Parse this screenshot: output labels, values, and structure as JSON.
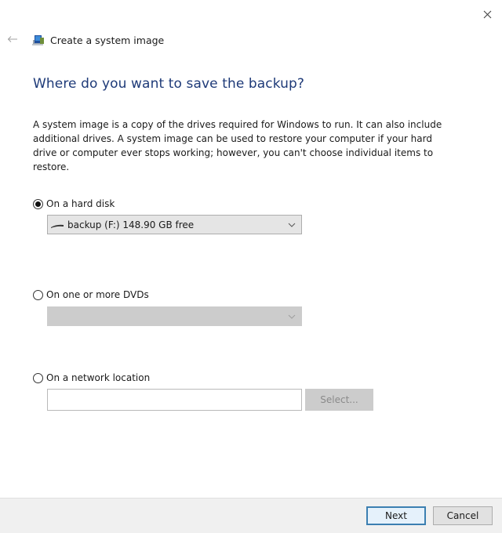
{
  "window": {
    "close_icon": "close-icon",
    "back_icon": "back-arrow-icon"
  },
  "wizard": {
    "title": "Create a system image",
    "app_icon": "system-image-icon"
  },
  "heading": "Where do you want to save the backup?",
  "description": "A system image is a copy of the drives required for Windows to run. It can also include additional drives. A system image can be used to restore your computer if your hard drive or computer ever stops working; however, you can't choose individual items to restore.",
  "options": {
    "hard_disk": {
      "label": "On a hard disk",
      "selected": true,
      "dropdown_value": "backup (F:)  148.90 GB free",
      "dropdown_icon": "drive-icon"
    },
    "dvds": {
      "label": "On one or more DVDs",
      "selected": false,
      "dropdown_value": "",
      "disabled": true
    },
    "network": {
      "label": "On a network location",
      "selected": false,
      "input_value": "",
      "select_button": "Select...",
      "select_disabled": true
    }
  },
  "footer": {
    "next_label": "Next",
    "cancel_label": "Cancel"
  },
  "colors": {
    "heading": "#1e3a78",
    "primary_button_border": "#3c7fb1",
    "footer_bg": "#f0f0f0",
    "disabled_bg": "#cccccc"
  }
}
